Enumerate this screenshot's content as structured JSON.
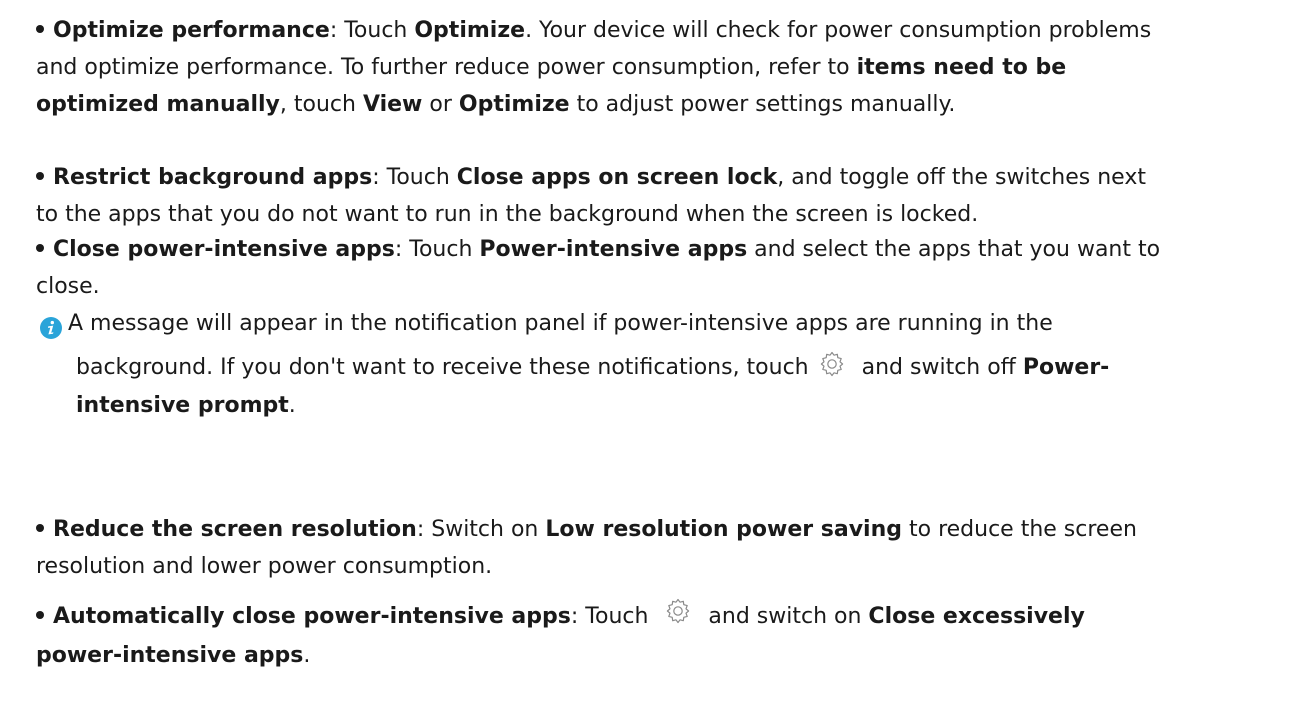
{
  "items": [
    {
      "title": "Optimize performance",
      "l1_a": ": Touch ",
      "l1_b": "Optimize",
      "l1_c": ". Your device will check for power consumption problems",
      "l2_a": "and optimize performance. To further reduce power consumption, refer to ",
      "l2_b": "items need to be",
      "l3_a": "optimized manually",
      "l3_b": ", touch ",
      "l3_c": "View",
      "l3_d": " or ",
      "l3_e": "Optimize",
      "l3_f": " to adjust power settings manually."
    },
    {
      "title": "Restrict background apps",
      "l1_a": ": Touch ",
      "l1_b": "Close apps on screen lock",
      "l1_c": ", and toggle off the switches next",
      "l2_a": "to the apps that you do not want to run in the background when the screen is locked."
    },
    {
      "title": "Close power-intensive apps",
      "l1_a": ": Touch ",
      "l1_b": "Power-intensive apps",
      "l1_c": " and select the apps that you want to",
      "l2_a": "close."
    },
    {
      "title": "Reduce the screen resolution",
      "l1_a": ": Switch on ",
      "l1_b": "Low resolution power saving",
      "l1_c": " to reduce the screen",
      "l2_a": "resolution and lower power consumption."
    },
    {
      "title": "Automatically close power-intensive apps",
      "l1_a": ": Touch ",
      "l1_b": " and switch on ",
      "l1_c": "Close excessively",
      "l2_a": "power-intensive apps",
      "l2_b": "."
    }
  ],
  "note": {
    "l1": "A message will appear in the notification panel if power-intensive apps are running in the",
    "l2_a": "background. If you don't want to receive these notifications, touch",
    "l2_b": " and switch off ",
    "l2_c": "Power-",
    "l3_a": "intensive prompt",
    "l3_b": "."
  },
  "icons": {
    "info": "info-icon",
    "settings": "gear-icon"
  },
  "colors": {
    "info_icon": "#2aa4d9",
    "gear_stroke": "#8a8a8a",
    "text": "#1a1a1a"
  }
}
